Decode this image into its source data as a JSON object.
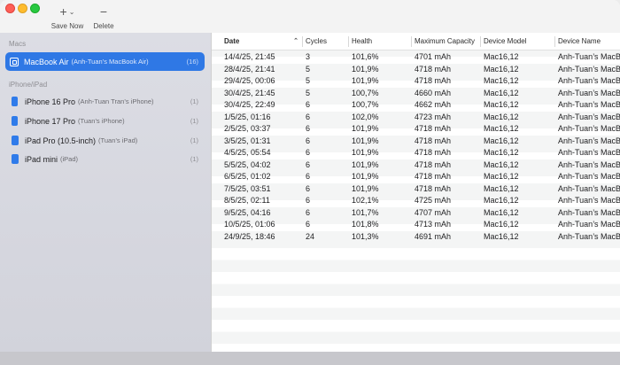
{
  "toolbar": {
    "add_glyph": "+",
    "add_chevron": "⌄",
    "save_label": "Save Now",
    "delete_glyph": "−",
    "delete_label": "Delete"
  },
  "sidebar": {
    "macs_title": "Macs",
    "iphone_title": "iPhone/iPad",
    "macs": [
      {
        "name": "MacBook Air",
        "sub": "(Anh-Tuan’s MacBook Air)",
        "count": "(16)",
        "icon": "laptop-icon"
      }
    ],
    "ios": [
      {
        "name": "iPhone 16 Pro",
        "sub": "(Anh-Tuan Tran’s iPhone)",
        "count": "(1)",
        "icon": "phone-icon"
      },
      {
        "name": "iPhone 17 Pro",
        "sub": "(Tuan’s iPhone)",
        "count": "(1)",
        "icon": "phone-icon"
      },
      {
        "name": "iPad Pro (10.5-inch)",
        "sub": "(Tuan’s iPad)",
        "count": "(1)",
        "icon": "tablet-icon"
      },
      {
        "name": "iPad mini",
        "sub": "(iPad)",
        "count": "(1)",
        "icon": "tablet-icon"
      }
    ]
  },
  "table": {
    "columns": [
      "Date",
      "Cycles",
      "Health",
      "Maximum Capacity",
      "Device Model",
      "Device Name"
    ],
    "sort_indicator": "⌃",
    "rows": [
      [
        "14/4/25, 21:45",
        "3",
        "101,6%",
        "4701 mAh",
        "Mac16,12",
        "Anh-Tuan’s MacBook Air"
      ],
      [
        "28/4/25, 21:41",
        "5",
        "101,9%",
        "4718 mAh",
        "Mac16,12",
        "Anh-Tuan’s MacBook Air"
      ],
      [
        "29/4/25, 00:06",
        "5",
        "101,9%",
        "4718 mAh",
        "Mac16,12",
        "Anh-Tuan’s MacBook Air"
      ],
      [
        "30/4/25, 21:45",
        "5",
        "100,7%",
        "4660 mAh",
        "Mac16,12",
        "Anh-Tuan’s MacBook Air"
      ],
      [
        "30/4/25, 22:49",
        "6",
        "100,7%",
        "4662 mAh",
        "Mac16,12",
        "Anh-Tuan’s MacBook Air"
      ],
      [
        "1/5/25, 01:16",
        "6",
        "102,0%",
        "4723 mAh",
        "Mac16,12",
        "Anh-Tuan’s MacBook Air"
      ],
      [
        "2/5/25, 03:37",
        "6",
        "101,9%",
        "4718 mAh",
        "Mac16,12",
        "Anh-Tuan’s MacBook Air"
      ],
      [
        "3/5/25, 01:31",
        "6",
        "101,9%",
        "4718 mAh",
        "Mac16,12",
        "Anh-Tuan’s MacBook Air"
      ],
      [
        "4/5/25, 05:54",
        "6",
        "101,9%",
        "4718 mAh",
        "Mac16,12",
        "Anh-Tuan’s MacBook Air"
      ],
      [
        "5/5/25, 04:02",
        "6",
        "101,9%",
        "4718 mAh",
        "Mac16,12",
        "Anh-Tuan’s MacBook Air"
      ],
      [
        "6/5/25, 01:02",
        "6",
        "101,9%",
        "4718 mAh",
        "Mac16,12",
        "Anh-Tuan’s MacBook Air"
      ],
      [
        "7/5/25, 03:51",
        "6",
        "101,9%",
        "4718 mAh",
        "Mac16,12",
        "Anh-Tuan’s MacBook Air"
      ],
      [
        "8/5/25, 02:11",
        "6",
        "102,1%",
        "4725 mAh",
        "Mac16,12",
        "Anh-Tuan’s MacBook Air"
      ],
      [
        "9/5/25, 04:16",
        "6",
        "101,7%",
        "4707 mAh",
        "Mac16,12",
        "Anh-Tuan’s MacBook Air"
      ],
      [
        "10/5/25, 01:06",
        "6",
        "101,8%",
        "4713 mAh",
        "Mac16,12",
        "Anh-Tuan’s MacBook Air"
      ],
      [
        "24/9/25, 18:46",
        "24",
        "101,3%",
        "4691 mAh",
        "Mac16,12",
        "Anh-Tuan’s MacBook Air"
      ]
    ]
  }
}
